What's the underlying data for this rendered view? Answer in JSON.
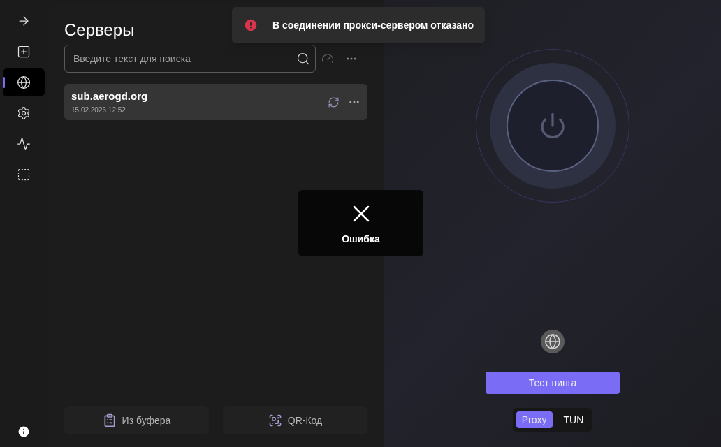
{
  "sidebar": {
    "items": [
      {
        "kind": "arrow",
        "selected": false
      },
      {
        "kind": "add",
        "selected": false
      },
      {
        "kind": "globe",
        "selected": true
      },
      {
        "kind": "settings",
        "selected": false
      },
      {
        "kind": "activity",
        "selected": false
      },
      {
        "kind": "dashed",
        "selected": false
      }
    ]
  },
  "servers": {
    "title": "Серверы",
    "search": {
      "placeholder": "Введите текст для поиска"
    },
    "subscriptions": [
      {
        "name": "sub.aerogd.org",
        "date": "15.02.2026 12:52"
      }
    ],
    "buttons": [
      {
        "kind": "clipboard",
        "label": "Из буфера"
      },
      {
        "kind": "qr",
        "label": "QR-Код"
      }
    ]
  },
  "toast": {
    "message": "В соединении прокси-сервером отказано"
  },
  "dialog": {
    "label": "Ошибка"
  },
  "connection": {
    "ping_button": "Тест пинга",
    "modes": [
      {
        "label": "Proxy",
        "selected": true
      },
      {
        "label": "TUN",
        "selected": false
      }
    ]
  }
}
